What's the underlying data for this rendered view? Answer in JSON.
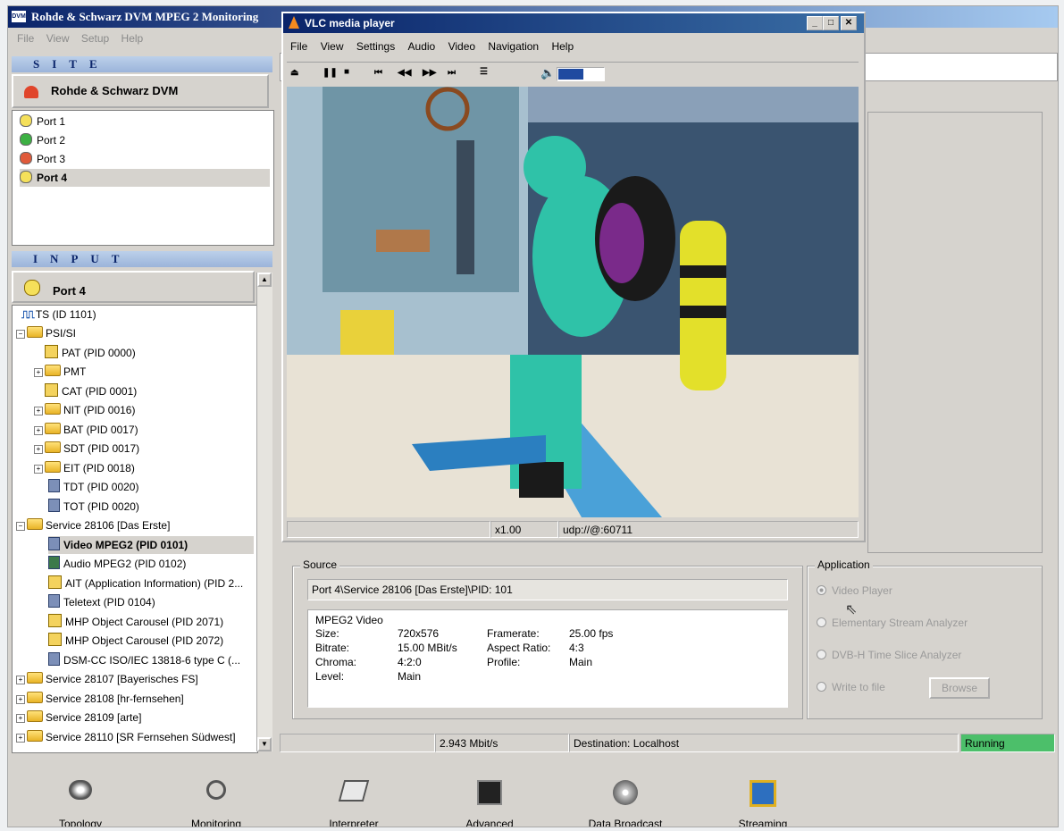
{
  "app": {
    "title": "Rohde & Schwarz DVM MPEG 2 Monitoring",
    "icon_label": "DVM",
    "menu": [
      "File",
      "View",
      "Setup",
      "Help"
    ]
  },
  "site": {
    "header": "SITE",
    "name": "Rohde & Schwarz DVM",
    "ports": [
      {
        "label": "Port 1",
        "color": "#f5e05a"
      },
      {
        "label": "Port 2",
        "color": "#3cb043"
      },
      {
        "label": "Port 3",
        "color": "#e05a3a"
      },
      {
        "label": "Port 4",
        "color": "#f5e05a"
      }
    ]
  },
  "input": {
    "header": "INPUT",
    "port": "Port 4",
    "tree": [
      "TS (ID 1101)",
      "PSI/SI",
      "PAT (PID 0000)",
      "PMT",
      "CAT (PID 0001)",
      "NIT (PID 0016)",
      "BAT (PID 0017)",
      "SDT (PID 0017)",
      "EIT (PID 0018)",
      "TDT (PID 0020)",
      "TOT (PID 0020)",
      "Service 28106 [Das Erste]",
      "Video MPEG2 (PID 0101)",
      "Audio MPEG2 (PID 0102)",
      "AIT (Application Information) (PID 2...",
      "Teletext (PID 0104)",
      "MHP Object Carousel (PID 2071)",
      "MHP Object Carousel (PID 2072)",
      "DSM-CC ISO/IEC 13818-6 type C (...",
      "Service 28107 [Bayerisches FS]",
      "Service 28108 [hr-fernsehen]",
      "Service 28109 [arte]",
      "Service 28110 [SR Fernsehen Südwest]"
    ]
  },
  "vlc": {
    "title": "VLC media player",
    "menu": [
      "File",
      "View",
      "Settings",
      "Audio",
      "Video",
      "Navigation",
      "Help"
    ],
    "speed": "x1.00",
    "url": "udp://@:60711",
    "volume_level": 0.55
  },
  "source": {
    "label": "Source",
    "path": "Port 4\\Service 28106 [Das Erste]\\PID: 101",
    "stream_type": "MPEG2 Video",
    "left": [
      {
        "k": "Size:",
        "v": "720x576"
      },
      {
        "k": "Bitrate:",
        "v": "15.00 MBit/s"
      },
      {
        "k": "Chroma:",
        "v": "4:2:0"
      },
      {
        "k": "Level:",
        "v": "Main"
      }
    ],
    "right": [
      {
        "k": "Framerate:",
        "v": "25.00 fps"
      },
      {
        "k": "Aspect Ratio:",
        "v": "4:3"
      },
      {
        "k": "Profile:",
        "v": "Main"
      }
    ]
  },
  "application": {
    "label": "Application",
    "options": [
      "Video Player",
      "Elementary Stream Analyzer",
      "DVB-H Time Slice Analyzer",
      "Write to file"
    ],
    "browse": "Browse"
  },
  "status": {
    "bitrate": "2.943 Mbit/s",
    "destination": "Destination: Localhost",
    "state": "Running"
  },
  "toolbar": {
    "items": [
      "Topology",
      "Monitoring",
      "Interpreter",
      "Advanced",
      "Data Broadcast",
      "Streaming"
    ]
  }
}
